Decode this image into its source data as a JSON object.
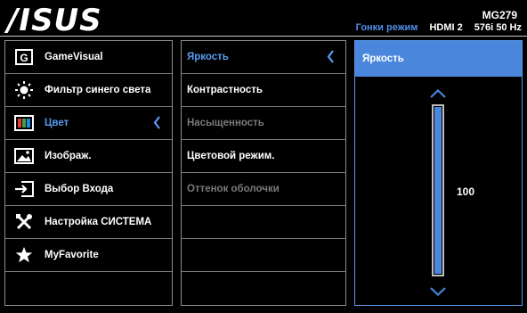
{
  "brand": {
    "logo": "/ISUS"
  },
  "header": {
    "model": "MG279",
    "mode": "Гонки режим",
    "input": "HDMI 2",
    "signal": "576i 50 Hz"
  },
  "main_menu": [
    {
      "label": "GameVisual",
      "icon": "gamevisual-icon"
    },
    {
      "label": "Фильтр синего света",
      "icon": "blue-light-icon"
    },
    {
      "label": "Цвет",
      "icon": "color-icon",
      "selected": true
    },
    {
      "label": "Изображ.",
      "icon": "image-icon"
    },
    {
      "label": "Выбор Входа",
      "icon": "input-select-icon"
    },
    {
      "label": "Настройка СИСТЕМА",
      "icon": "tools-icon"
    },
    {
      "label": "MyFavorite",
      "icon": "star-icon"
    }
  ],
  "sub_menu": [
    {
      "label": "Яркость",
      "state": "selected"
    },
    {
      "label": "Контрастность",
      "state": "enabled"
    },
    {
      "label": "Насыщенность",
      "state": "disabled"
    },
    {
      "label": "Цветовой режим.",
      "state": "enabled"
    },
    {
      "label": "Оттенок оболочки",
      "state": "disabled"
    }
  ],
  "adjust_panel": {
    "title": "Яркость",
    "value": "100",
    "level_percent": 100
  },
  "colors": {
    "accent": "#4a86dc",
    "selected_text": "#5a9cf2",
    "disabled_text": "#7a7a7a"
  }
}
